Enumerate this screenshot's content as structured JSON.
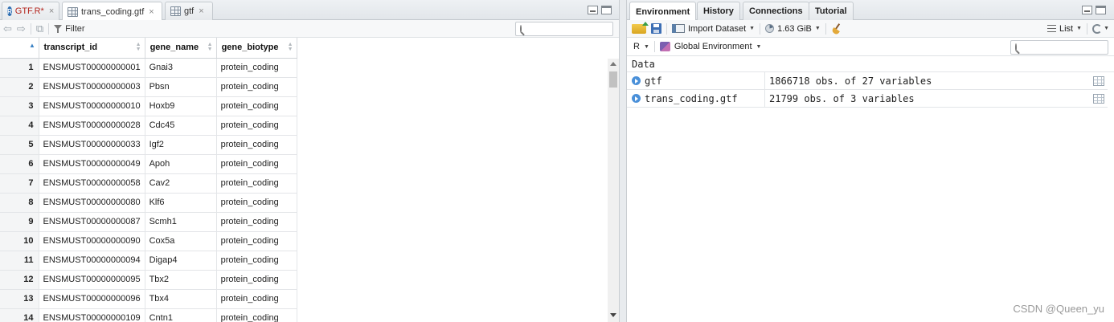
{
  "left": {
    "tabs": [
      {
        "label": "GTF.R*",
        "icon": "r-file-icon",
        "modified": true
      },
      {
        "label": "trans_coding.gtf",
        "icon": "grid-icon",
        "active": true
      },
      {
        "label": "gtf",
        "icon": "grid-icon"
      }
    ],
    "close_glyph": "×",
    "filter_label": "Filter",
    "search_placeholder": "",
    "columns": [
      "transcript_id",
      "gene_name",
      "gene_biotype"
    ],
    "rows": [
      {
        "n": "1",
        "transcript_id": "ENSMUST00000000001",
        "gene_name": "Gnai3",
        "gene_biotype": "protein_coding"
      },
      {
        "n": "2",
        "transcript_id": "ENSMUST00000000003",
        "gene_name": "Pbsn",
        "gene_biotype": "protein_coding"
      },
      {
        "n": "3",
        "transcript_id": "ENSMUST00000000010",
        "gene_name": "Hoxb9",
        "gene_biotype": "protein_coding"
      },
      {
        "n": "4",
        "transcript_id": "ENSMUST00000000028",
        "gene_name": "Cdc45",
        "gene_biotype": "protein_coding"
      },
      {
        "n": "5",
        "transcript_id": "ENSMUST00000000033",
        "gene_name": "Igf2",
        "gene_biotype": "protein_coding"
      },
      {
        "n": "6",
        "transcript_id": "ENSMUST00000000049",
        "gene_name": "Apoh",
        "gene_biotype": "protein_coding"
      },
      {
        "n": "7",
        "transcript_id": "ENSMUST00000000058",
        "gene_name": "Cav2",
        "gene_biotype": "protein_coding"
      },
      {
        "n": "8",
        "transcript_id": "ENSMUST00000000080",
        "gene_name": "Klf6",
        "gene_biotype": "protein_coding"
      },
      {
        "n": "9",
        "transcript_id": "ENSMUST00000000087",
        "gene_name": "Scmh1",
        "gene_biotype": "protein_coding"
      },
      {
        "n": "10",
        "transcript_id": "ENSMUST00000000090",
        "gene_name": "Cox5a",
        "gene_biotype": "protein_coding"
      },
      {
        "n": "11",
        "transcript_id": "ENSMUST00000000094",
        "gene_name": "Digap4",
        "gene_biotype": "protein_coding"
      },
      {
        "n": "12",
        "transcript_id": "ENSMUST00000000095",
        "gene_name": "Tbx2",
        "gene_biotype": "protein_coding"
      },
      {
        "n": "13",
        "transcript_id": "ENSMUST00000000096",
        "gene_name": "Tbx4",
        "gene_biotype": "protein_coding"
      },
      {
        "n": "14",
        "transcript_id": "ENSMUST00000000109",
        "gene_name": "Cntn1",
        "gene_biotype": "protein_coding"
      }
    ]
  },
  "right": {
    "tabs": [
      "Environment",
      "History",
      "Connections",
      "Tutorial"
    ],
    "active_tab": "Environment",
    "toolbar": {
      "import_label": "Import Dataset",
      "memory_label": "1.63 GiB",
      "view_label": "List"
    },
    "lang_label": "R",
    "env_label": "Global Environment",
    "search_placeholder": "",
    "section_label": "Data",
    "objects": [
      {
        "name": "gtf",
        "value": "1866718 obs. of 27 variables"
      },
      {
        "name": "trans_coding.gtf",
        "value": "21799 obs. of 3 variables"
      }
    ]
  },
  "watermark": "CSDN @Queen_yu",
  "colors": {
    "modified_tab": "#b3261e",
    "accent": "#3b82c4"
  }
}
